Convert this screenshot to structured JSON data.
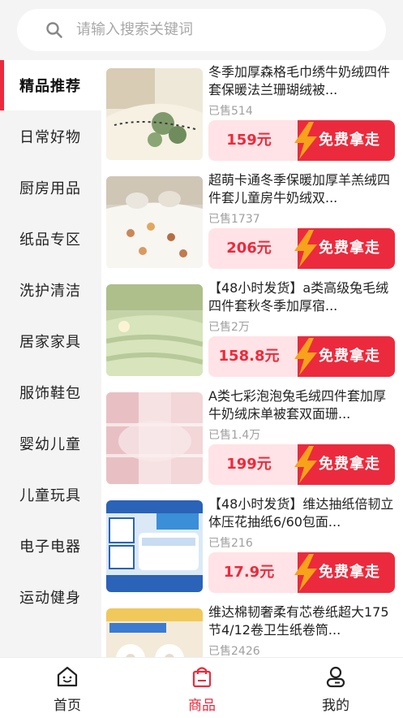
{
  "search": {
    "placeholder": "请输入搜索关键词"
  },
  "categories": [
    {
      "label": "精品推荐",
      "active": true
    },
    {
      "label": "日常好物"
    },
    {
      "label": "厨房用品"
    },
    {
      "label": "纸品专区"
    },
    {
      "label": "洗护清洁"
    },
    {
      "label": "居家家具"
    },
    {
      "label": "服饰鞋包"
    },
    {
      "label": "婴幼儿童"
    },
    {
      "label": "儿童玩具"
    },
    {
      "label": "电子电器"
    },
    {
      "label": "运动健身"
    }
  ],
  "products": [
    {
      "title": "冬季加厚森格毛巾绣牛奶绒四件套保暖法兰珊瑚绒被...",
      "sold": "已售514",
      "price": "159元",
      "cta": "免费拿走"
    },
    {
      "title": "超萌卡通冬季保暖加厚羊羔绒四件套儿童房牛奶绒双...",
      "sold": "已售1737",
      "price": "206元",
      "cta": "免费拿走"
    },
    {
      "title": "【48小时发货】a类高级兔毛绒四件套秋冬季加厚宿...",
      "sold": "已售2万",
      "price": "158.8元",
      "cta": "免费拿走"
    },
    {
      "title": "A类七彩泡泡兔毛绒四件套加厚牛奶绒床单被套双面珊...",
      "sold": "已售1.4万",
      "price": "199元",
      "cta": "免费拿走"
    },
    {
      "title": "【48小时发货】维达抽纸倍韧立体压花抽纸6/60包面...",
      "sold": "已售216",
      "price": "17.9元",
      "cta": "免费拿走"
    },
    {
      "title": "维达棉韧奢柔有芯卷纸超大175节4/12卷卫生纸卷筒...",
      "sold": "已售2426",
      "price": "",
      "cta": ""
    }
  ],
  "tabbar": {
    "home": "首页",
    "goods": "商品",
    "mine": "我的"
  },
  "colors": {
    "accent": "#ec2a3d",
    "price_bg": "#ffe3e6",
    "bolt": "#f7a21b"
  }
}
